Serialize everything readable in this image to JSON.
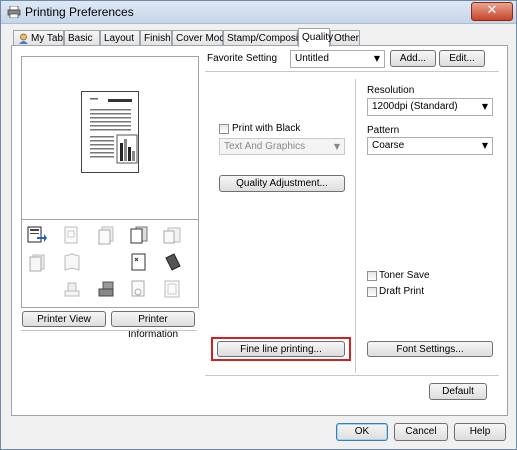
{
  "window": {
    "title": "Printing Preferences",
    "close_glyph": "✕"
  },
  "tabs": [
    {
      "label": "My Tab"
    },
    {
      "label": "Basic"
    },
    {
      "label": "Layout"
    },
    {
      "label": "Finish"
    },
    {
      "label": "Cover Mode"
    },
    {
      "label": "Stamp/Composition"
    },
    {
      "label": "Quality"
    },
    {
      "label": "Other"
    }
  ],
  "favorite": {
    "label": "Favorite Setting",
    "value": "Untitled",
    "add_label": "Add...",
    "edit_label": "Edit..."
  },
  "left": {
    "printer_view_label": "Printer View",
    "printer_info_label": "Printer Information"
  },
  "quality": {
    "print_with_black_label": "Print with Black",
    "print_with_black_value": "Text And Graphics",
    "quality_adjustment_label": "Quality Adjustment...",
    "fine_line_label": "Fine line printing..."
  },
  "right": {
    "resolution_label": "Resolution",
    "resolution_value": "1200dpi (Standard)",
    "pattern_label": "Pattern",
    "pattern_value": "Coarse",
    "toner_save_label": "Toner Save",
    "draft_print_label": "Draft Print",
    "font_settings_label": "Font Settings..."
  },
  "bottom": {
    "default_label": "Default",
    "ok_label": "OK",
    "cancel_label": "Cancel",
    "help_label": "Help"
  },
  "highlight_color": "#d32020"
}
